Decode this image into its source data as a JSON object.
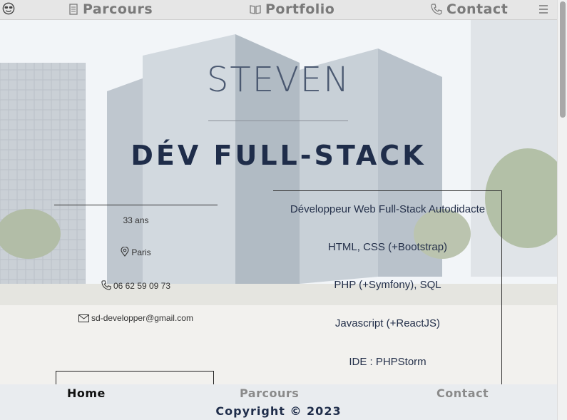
{
  "nav": {
    "items": [
      {
        "label": "Parcours",
        "icon": "document-icon"
      },
      {
        "label": "Portfolio",
        "icon": "book-icon"
      },
      {
        "label": "Contact",
        "icon": "phone-icon"
      }
    ],
    "logo_icon": "sunglasses-smiley-icon",
    "menu_icon": "hamburger-menu-icon"
  },
  "hero": {
    "name": "STEVEN",
    "role": "DÉV FULL-STACK"
  },
  "info": {
    "age": "33 ans",
    "city": "Paris",
    "phone": "06 62 59 09 73",
    "email": "sd-developper@gmail.com"
  },
  "skills": [
    "Développeur Web Full-Stack Autodidacte",
    "HTML, CSS (+Bootstrap)",
    "PHP (+Symfony), SQL",
    "Javascript (+ReactJS)",
    "IDE : PHPStorm"
  ],
  "footer": {
    "links": [
      "Home",
      "Parcours",
      "Contact"
    ],
    "copyright": "Copyright © 2023"
  },
  "colors": {
    "title": "#4a5870",
    "subtitle": "#1f2d4a",
    "nav_text": "#7a7a7a"
  }
}
